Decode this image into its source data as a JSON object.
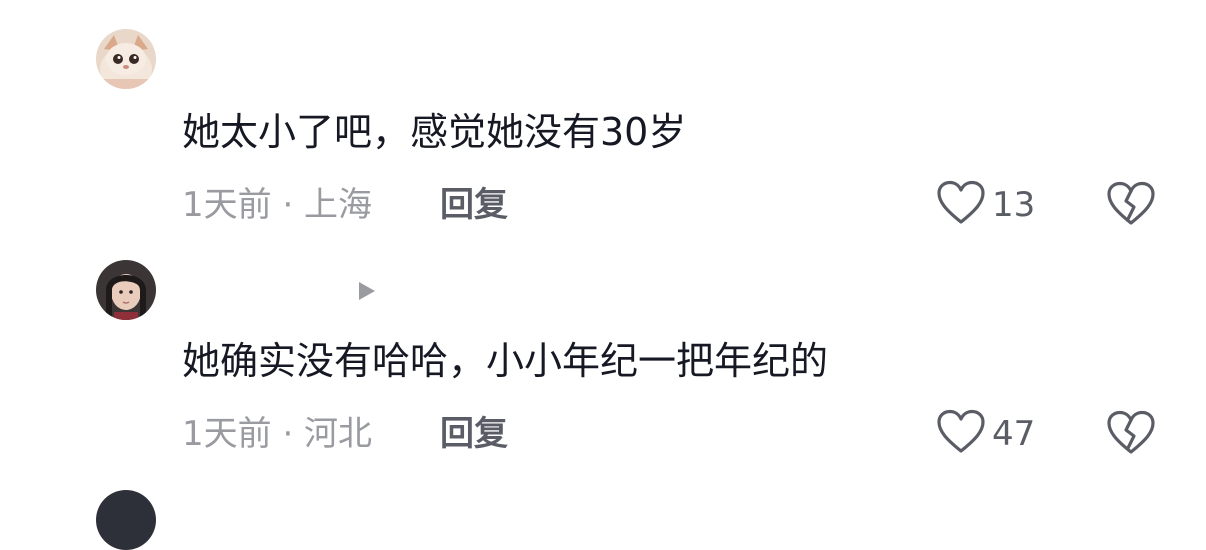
{
  "comments": [
    {
      "author": "",
      "text": "她太小了吧，感觉她没有30岁",
      "meta": "1天前 · 上海",
      "reply_label": "回复",
      "like_count": "13"
    },
    {
      "author": "",
      "text": "她确实没有哈哈，小小年纪一把年纪的",
      "meta": "1天前 · 河北",
      "reply_label": "回复",
      "like_count": "47"
    }
  ],
  "icons": {
    "like": "heart-outline-icon",
    "dislike": "broken-heart-icon",
    "author_tag": "play-triangle-icon"
  },
  "colors": {
    "text": "#161823",
    "meta": "#9a9ba1",
    "action": "#5b5d66"
  }
}
